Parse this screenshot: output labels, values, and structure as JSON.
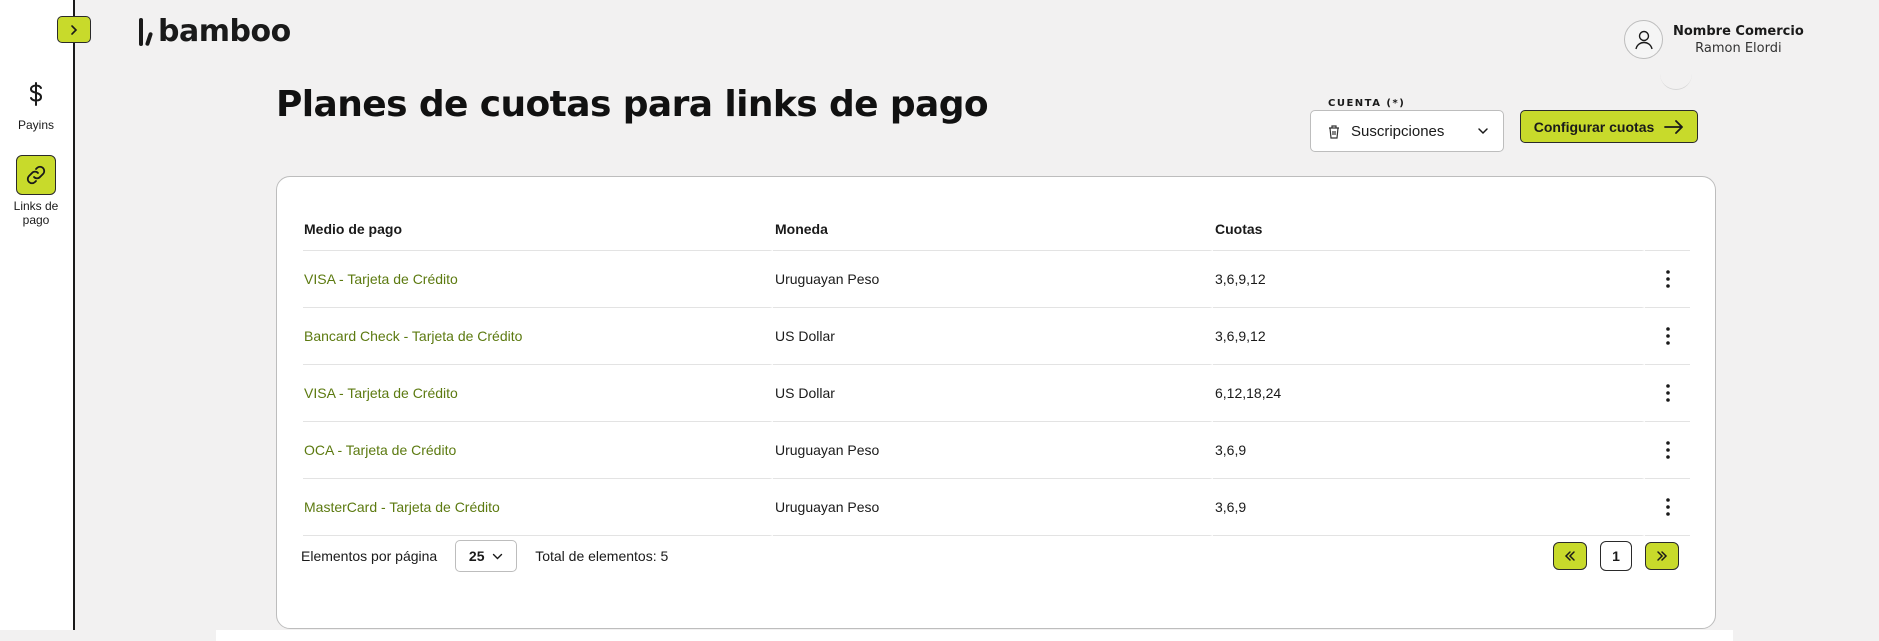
{
  "brand": {
    "name": "bamboo",
    "accent": "#c8da2b",
    "link_color": "#5c7a10"
  },
  "sidebar": {
    "toggle_icon": "chevron-right-icon",
    "items": [
      {
        "label": "Payins",
        "icon": "dollar-icon",
        "active": false
      },
      {
        "label": "Links de pago",
        "icon": "link-icon",
        "active": true
      }
    ]
  },
  "header": {
    "user_name": "Nombre Comercio",
    "user_sub": "Ramon Elordi",
    "avatar_icon": "user-icon"
  },
  "main": {
    "title": "Planes de cuotas para links de pago",
    "account_select": {
      "legend": "CUENTA (*)",
      "value": "Suscripciones",
      "icon": "trash-icon"
    },
    "config_button": "Configurar cuotas"
  },
  "table": {
    "headers": [
      "Medio de pago",
      "Moneda",
      "Cuotas"
    ],
    "rows": [
      {
        "medio": "VISA - Tarjeta de Crédito",
        "moneda": "Uruguayan Peso",
        "cuotas": "3,6,9,12"
      },
      {
        "medio": "Bancard Check - Tarjeta de Crédito",
        "moneda": "US Dollar",
        "cuotas": "3,6,9,12"
      },
      {
        "medio": "VISA - Tarjeta de Crédito",
        "moneda": "US Dollar",
        "cuotas": "6,12,18,24"
      },
      {
        "medio": "OCA - Tarjeta de Crédito",
        "moneda": "Uruguayan Peso",
        "cuotas": "3,6,9"
      },
      {
        "medio": "MasterCard - Tarjeta de Crédito",
        "moneda": "Uruguayan Peso",
        "cuotas": "3,6,9"
      }
    ]
  },
  "footer": {
    "per_page_label": "Elementos por página",
    "per_page_value": "25",
    "total_label": "Total de elementos: 5",
    "current_page": "1",
    "prev_icon": "double-chevron-left-icon",
    "next_icon": "double-chevron-right-icon"
  }
}
